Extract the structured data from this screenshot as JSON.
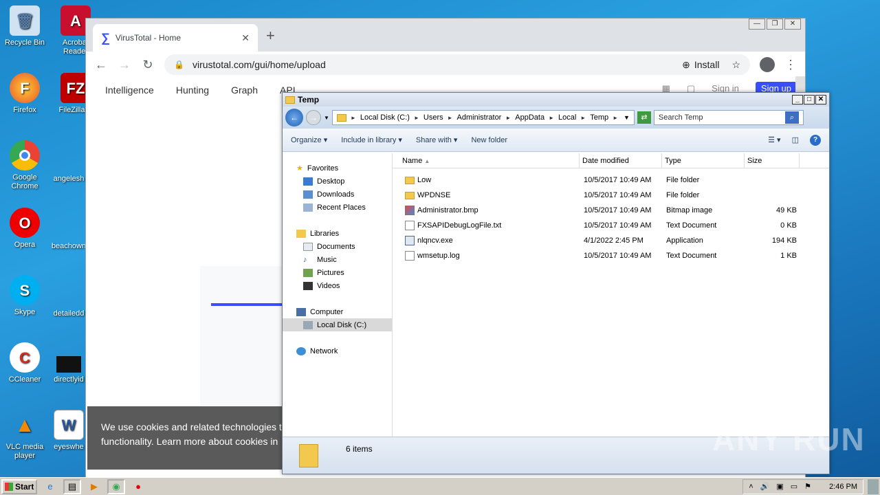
{
  "desktop": {
    "icons": [
      {
        "label": "Recycle Bin"
      },
      {
        "label": "Acrobat Reader"
      },
      {
        "label": "Firefox"
      },
      {
        "label": "FileZilla C"
      },
      {
        "label": "Google Chrome"
      },
      {
        "label": "angelesh"
      },
      {
        "label": "Opera"
      },
      {
        "label": "beachown"
      },
      {
        "label": "Skype"
      },
      {
        "label": "detailedd"
      },
      {
        "label": "CCleaner"
      },
      {
        "label": "directlyid"
      },
      {
        "label": "VLC media player"
      },
      {
        "label": "eyeswhe"
      }
    ]
  },
  "browser": {
    "tab_title": "VirusTotal - Home",
    "url": "virustotal.com/gui/home/upload",
    "install_label": "Install",
    "nav": [
      "Intelligence",
      "Hunting",
      "Graph",
      "API"
    ],
    "sign_in": "Sign in",
    "sign_up": "Sign up",
    "cookie_text_1": "We use cookies and related technologies t",
    "cookie_text_2": "functionality. Learn more about cookies in"
  },
  "explorer": {
    "title": "Temp",
    "breadcrumbs": [
      "Local Disk (C:)",
      "Users",
      "Administrator",
      "AppData",
      "Local",
      "Temp"
    ],
    "search_placeholder": "Search Temp",
    "commands": [
      "Organize",
      "Include in library",
      "Share with",
      "New folder"
    ],
    "nav": {
      "favorites": "Favorites",
      "favorites_items": [
        "Desktop",
        "Downloads",
        "Recent Places"
      ],
      "libraries": "Libraries",
      "libraries_items": [
        "Documents",
        "Music",
        "Pictures",
        "Videos"
      ],
      "computer": "Computer",
      "computer_items": [
        "Local Disk (C:)"
      ],
      "network": "Network"
    },
    "columns": [
      "Name",
      "Date modified",
      "Type",
      "Size"
    ],
    "files": [
      {
        "name": "Low",
        "date": "10/5/2017 10:49 AM",
        "type": "File folder",
        "size": "",
        "icon": "folder"
      },
      {
        "name": "WPDNSE",
        "date": "10/5/2017 10:49 AM",
        "type": "File folder",
        "size": "",
        "icon": "folder"
      },
      {
        "name": "Administrator.bmp",
        "date": "10/5/2017 10:49 AM",
        "type": "Bitmap image",
        "size": "49 KB",
        "icon": "bmp"
      },
      {
        "name": "FXSAPIDebugLogFile.txt",
        "date": "10/5/2017 10:49 AM",
        "type": "Text Document",
        "size": "0 KB",
        "icon": "txt"
      },
      {
        "name": "nlqncv.exe",
        "date": "4/1/2022 2:45 PM",
        "type": "Application",
        "size": "194 KB",
        "icon": "exe"
      },
      {
        "name": "wmsetup.log",
        "date": "10/5/2017 10:49 AM",
        "type": "Text Document",
        "size": "1 KB",
        "icon": "txt"
      }
    ],
    "status": "6 items"
  },
  "taskbar": {
    "start_label": "Start",
    "clock": "2:46 PM"
  },
  "watermark": "ANY RUN"
}
